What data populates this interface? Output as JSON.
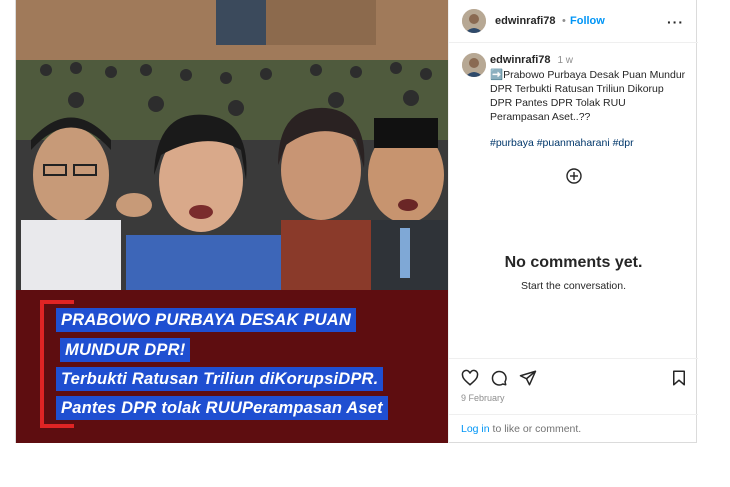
{
  "post": {
    "image_caption_lines": [
      "PRABOWO PURBAYA DESAK PUAN",
      "MUNDUR DPR!",
      "Terbukti Ratusan Triliun diKorupsiDPR.",
      "Pantes DPR tolak RUUPerampasan Aset"
    ]
  },
  "header": {
    "username": "edwinrafi78",
    "separator": "•",
    "follow_label": "Follow",
    "more_label": "···"
  },
  "caption": {
    "username": "edwinrafi78",
    "time": "1 w",
    "text": "➡️Prabowo Purbaya Desak Puan Mundur DPR Terbukti Ratusan Triliun Dikorup DPR Pantes DPR Tolak RUU Perampasan Aset..??",
    "hashtags": "#purbaya #puanmaharani #dpr"
  },
  "comments": {
    "empty_title": "No comments yet.",
    "empty_subtitle": "Start the conversation."
  },
  "footer": {
    "date": "9 February",
    "login_link": "Log in",
    "login_text": " to like or comment."
  },
  "colors": {
    "accent": "#0095f6",
    "hashtag": "#00376b",
    "banner_bg": "#5e0d10",
    "caption_highlight": "#1f4fd1",
    "bracket": "#e02424"
  }
}
